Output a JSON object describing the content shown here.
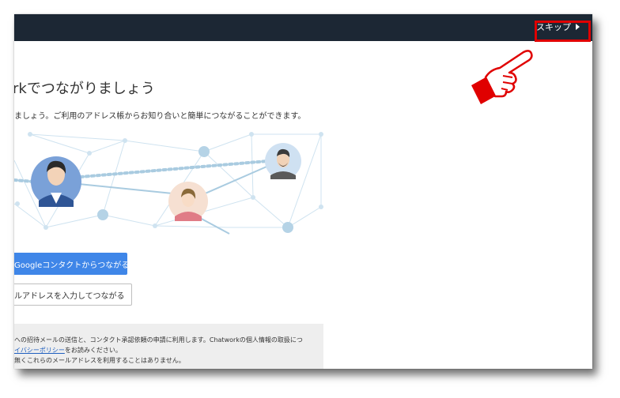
{
  "header": {
    "skip_label": "スキップ",
    "highlight_color": "#e00000",
    "bar_color": "#1c2734"
  },
  "main": {
    "title": "rkでつながりましょう",
    "subtitle": "ましょう。ご利用のアドレス帳からお知り合いと簡単につながることができます。",
    "google_button_label": "Googleコンタクトからつながる",
    "email_button_label": "ルアドレスを入力してつながる",
    "accent_color": "#3f86e8"
  },
  "notice": {
    "line1": "への招待メールの送信と、コンタクト承認依頼の申請に利用します。Chatworkの個人情報の取扱につ",
    "line2_link": "イバシーポリシー",
    "line2_rest": "をお読みください。",
    "line3": "無くこれらのメールアドレスを利用することはありません。"
  },
  "icons": {
    "pointer": "pointing-hand-icon",
    "skip_arrow": "triangle-right-icon"
  }
}
